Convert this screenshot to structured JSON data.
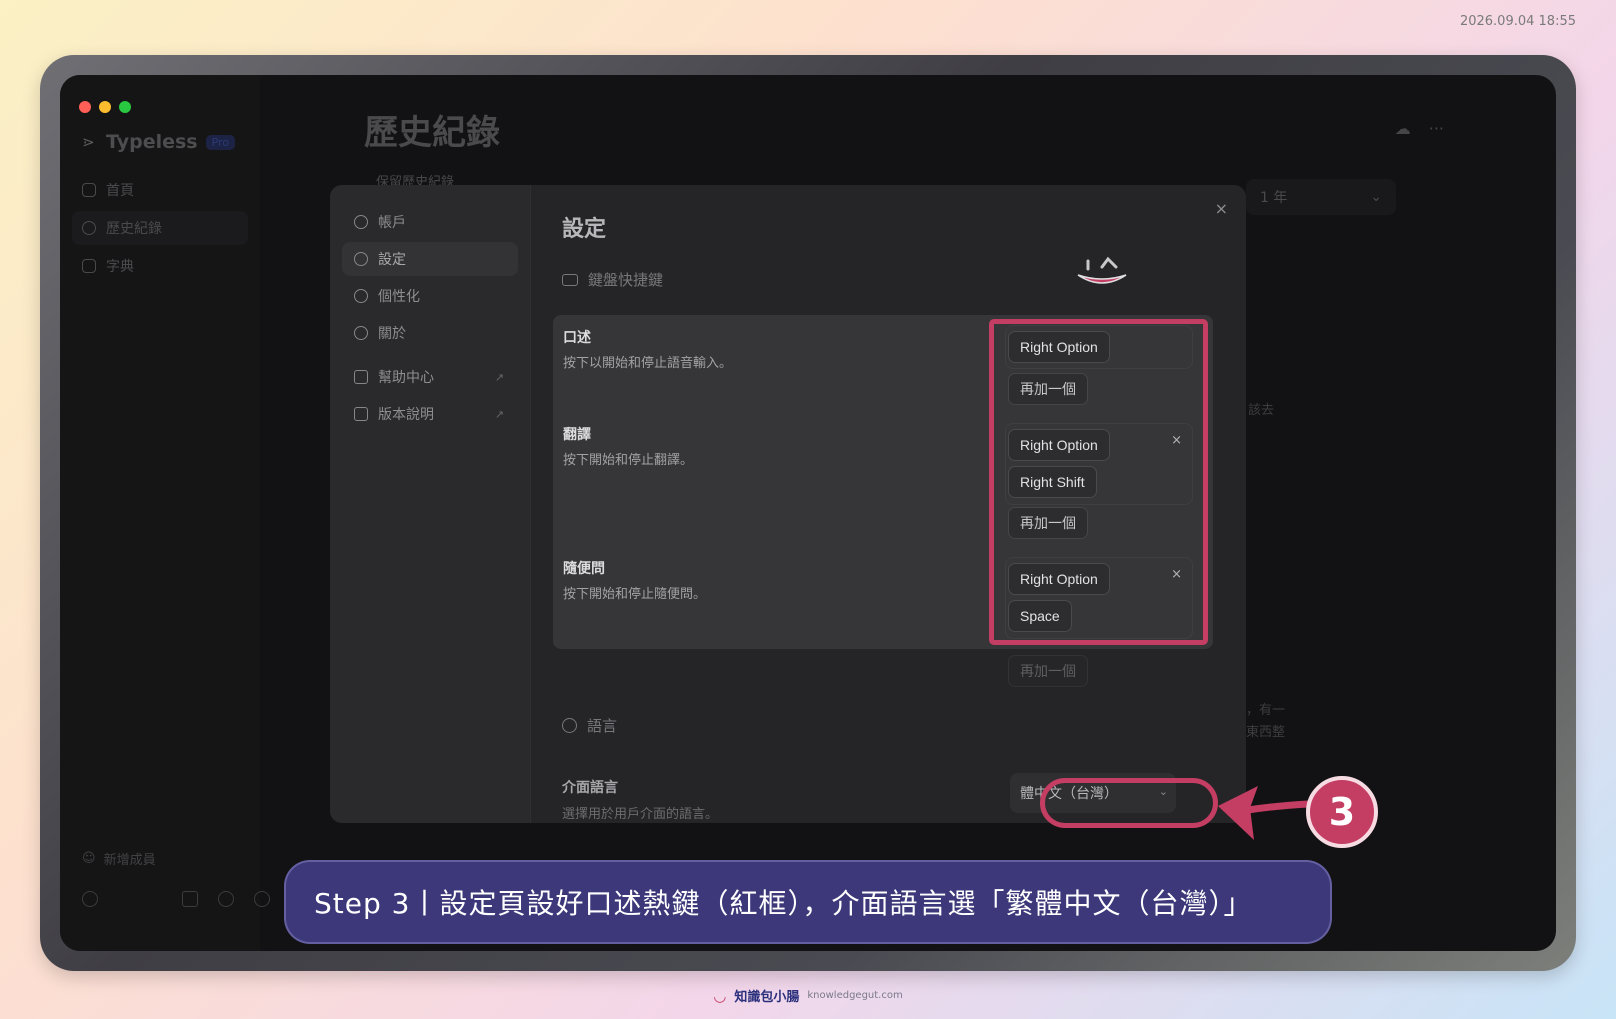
{
  "timestamp": "2026.09.04 18:55",
  "app": {
    "brand": "Typeless",
    "plan": "Pro",
    "nav": [
      {
        "label": "首頁"
      },
      {
        "label": "歷史紀錄"
      },
      {
        "label": "字典"
      }
    ],
    "add_member": "新增成員",
    "page_title": "歷史紀錄",
    "retain_label": "保留歷史紀錄",
    "retention_value": "1 年",
    "bg_snippets": [
      "該去",
      "，有一",
      "東西整"
    ]
  },
  "modal": {
    "title": "設定",
    "close": "×",
    "nav": [
      {
        "label": "帳戶"
      },
      {
        "label": "設定"
      },
      {
        "label": "個性化"
      },
      {
        "label": "關於"
      },
      {
        "label": "幫助中心",
        "ext": "↗"
      },
      {
        "label": "版本說明",
        "ext": "↗"
      }
    ],
    "keyboard_section": "鍵盤快捷鍵",
    "hotkeys": [
      {
        "label": "口述",
        "desc": "按下以開始和停止語音輸入。",
        "keys": [
          "Right Option"
        ],
        "add": "再加一個"
      },
      {
        "label": "翻譯",
        "desc": "按下開始和停止翻譯。",
        "keys": [
          "Right Option",
          "Right Shift"
        ],
        "add": "再加一個"
      },
      {
        "label": "隨便問",
        "desc": "按下開始和停止隨便問。",
        "keys": [
          "Right Option",
          "Space"
        ],
        "add": "再加一個"
      }
    ],
    "remove": "×",
    "language_section": "語言",
    "ui_language_label": "介面語言",
    "ui_language_desc": "選擇用於用戶介面的語言。",
    "ui_language_value": "體中文（台灣）"
  },
  "annotation": {
    "step_number": "3",
    "caption": "Step 3丨設定頁設好口述熱鍵（紅框），介面語言選「繁體中文（台灣）」",
    "accent": "#c43d63"
  },
  "footer": {
    "brand": "知識包小腸",
    "url": "knowledgegut.com"
  }
}
